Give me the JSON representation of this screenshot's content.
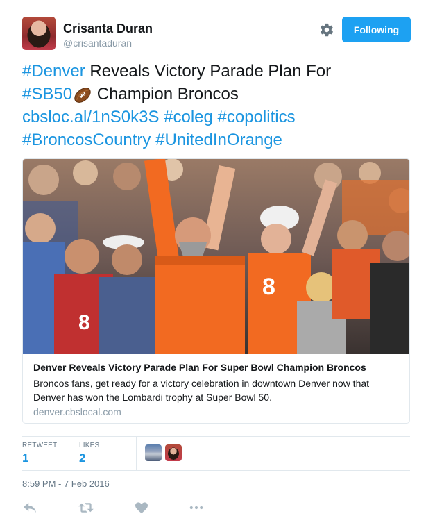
{
  "user": {
    "display_name": "Crisanta Duran",
    "screen_name": "@crisantaduran"
  },
  "follow_button": {
    "label": "Following"
  },
  "tweet": {
    "line1": {
      "tag1": "#Denver",
      "text1": " Reveals Victory Parade Plan For"
    },
    "line2": {
      "tag1": "#SB50",
      "emoji": "football-emoji",
      "text1": " Champion Broncos"
    },
    "line3": {
      "link": "cbsloc.al/1nS0k3S",
      "sp1": " ",
      "tag1": "#coleg",
      "sp2": " ",
      "tag2": "#copolitics"
    },
    "line4": {
      "tag1": "#BroncosCountry",
      "sp1": " ",
      "tag2": "#UnitedInOrange"
    }
  },
  "card": {
    "image": "crowd-of-cheering-broncos-fans-photo",
    "title": "Denver Reveals Victory Parade Plan For Super Bowl Champion Broncos",
    "description": "Broncos fans, get ready for a victory celebration in downtown Denver now that Denver has won the Lombardi trophy at Super Bowl 50.",
    "domain": "denver.cbslocal.com"
  },
  "stats": {
    "retweets_label": "RETWEET",
    "retweets_count": "1",
    "likes_label": "LIKES",
    "likes_count": "2"
  },
  "timestamp": "8:59 PM - 7 Feb 2016",
  "icons": [
    "gear-icon",
    "reply-icon",
    "retweet-icon",
    "like-icon",
    "more-icon"
  ],
  "colors": {
    "accent": "#1da1f2",
    "link": "#1b95e0",
    "muted": "#8899a6",
    "border": "#e1e8ed",
    "broncos_orange": "#f26a21"
  }
}
